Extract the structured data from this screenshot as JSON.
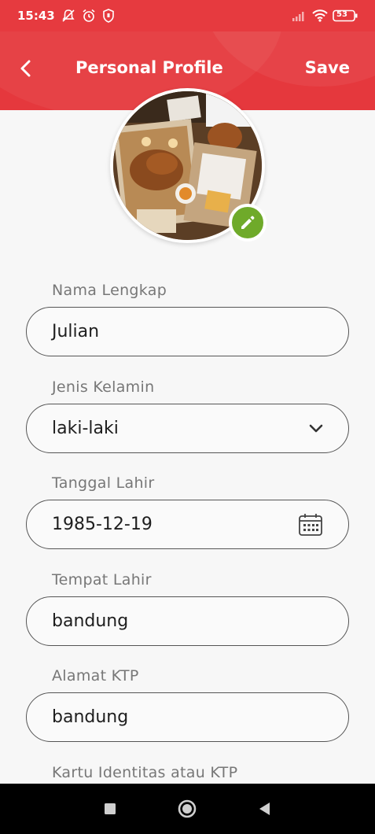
{
  "status_bar": {
    "time": "15:43",
    "battery": "53"
  },
  "header": {
    "title": "Personal Profile",
    "save_label": "Save"
  },
  "form": {
    "nama_lengkap": {
      "label": "Nama Lengkap",
      "value": "Julian"
    },
    "jenis_kelamin": {
      "label": "Jenis Kelamin",
      "value": "laki-laki"
    },
    "tanggal_lahir": {
      "label": "Tanggal Lahir",
      "value": "1985-12-19"
    },
    "tempat_lahir": {
      "label": "Tempat Lahir",
      "value": "bandung"
    },
    "alamat_ktp": {
      "label": "Alamat KTP",
      "value": "bandung"
    },
    "kartu_identitas": {
      "label": "Kartu Identitas atau KTP"
    }
  },
  "colors": {
    "brand_red": "#e5383d",
    "edit_green": "#6faa2a"
  }
}
